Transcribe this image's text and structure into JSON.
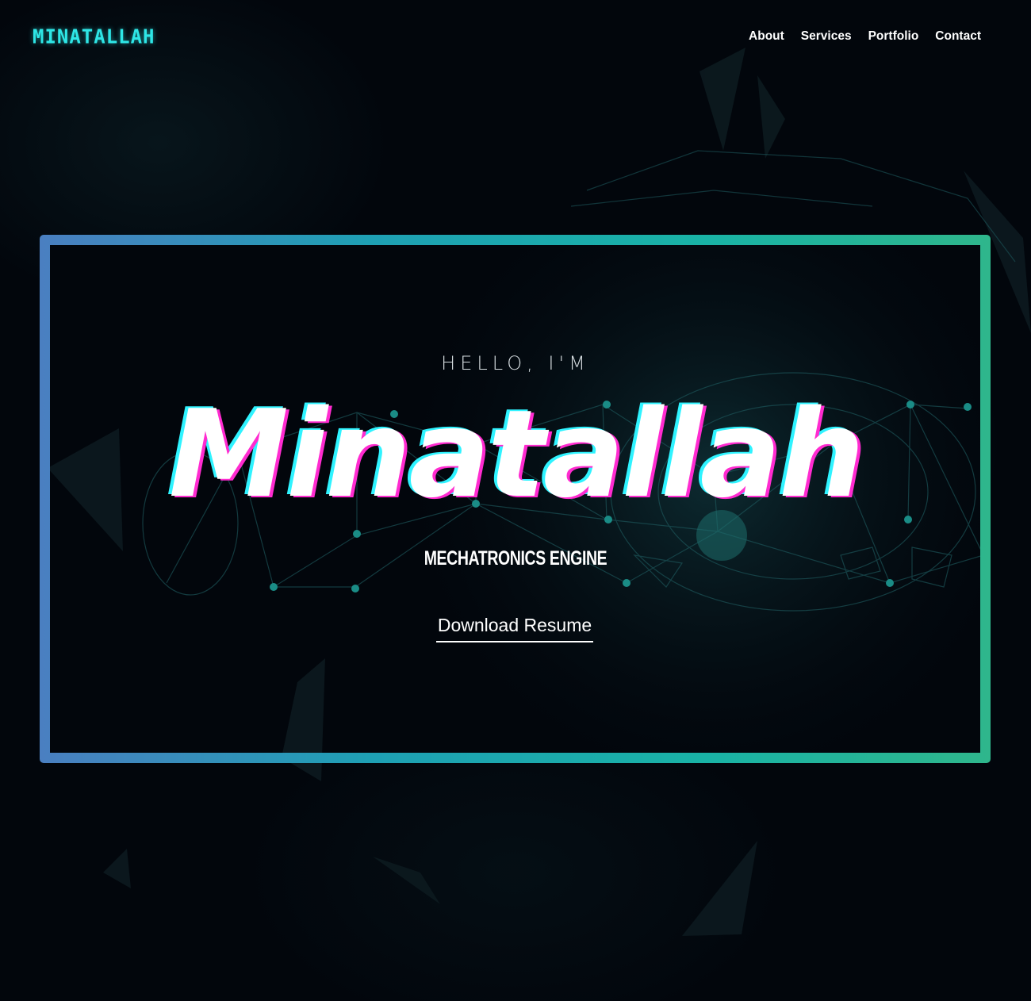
{
  "header": {
    "logo": "MINATALLAH",
    "nav": [
      {
        "label": "About"
      },
      {
        "label": "Services"
      },
      {
        "label": "Portfolio"
      },
      {
        "label": "Contact"
      }
    ]
  },
  "hero": {
    "greeting": "HELLO, I'M",
    "name": "Minatallah",
    "role": "MECHATRONICS ENGINE",
    "resume_label": "Download Resume"
  },
  "colors": {
    "background": "#02060c",
    "logo": "#2ee6e6",
    "frame_gradient_start": "#4a7fc1",
    "frame_gradient_end": "#2fb68c",
    "glitch_cyan": "#2ff3ff",
    "glitch_pink": "#ff2bd0"
  }
}
